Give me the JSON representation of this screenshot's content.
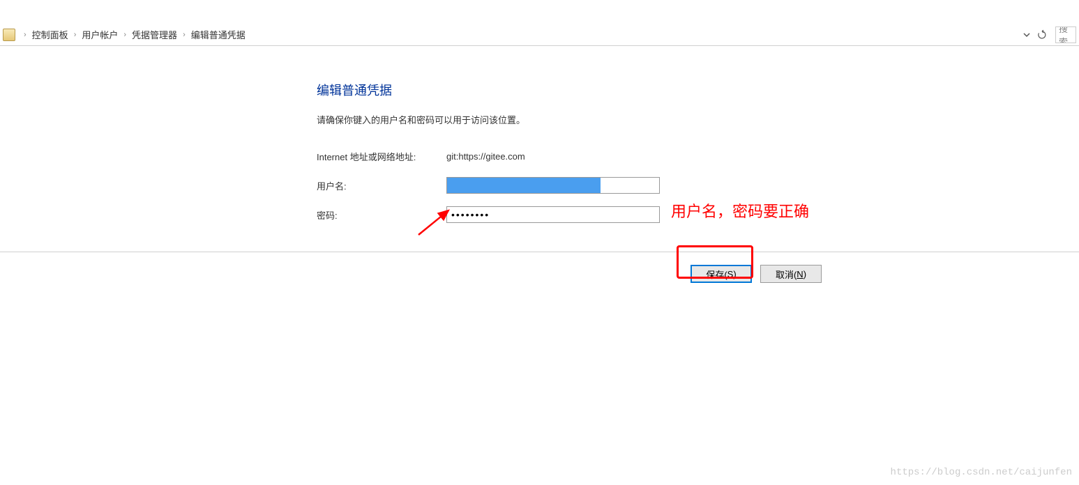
{
  "breadcrumb": {
    "items": [
      "控制面板",
      "用户帐户",
      "凭据管理器",
      "编辑普通凭据"
    ]
  },
  "search": {
    "placeholder": "搜索"
  },
  "page": {
    "title": "编辑普通凭据",
    "instructions": "请确保你键入的用户名和密码可以用于访问该位置。"
  },
  "form": {
    "address_label": "Internet 地址或网络地址:",
    "address_value": "git:https://gitee.com",
    "username_label": "用户名:",
    "password_label": "密码:",
    "password_value": "••••••••"
  },
  "buttons": {
    "save": "保存(",
    "save_key": "S",
    "save_close": ")",
    "cancel": "取消(",
    "cancel_key": "N",
    "cancel_close": ")"
  },
  "annotation": {
    "text": "用户名，密码要正确"
  },
  "watermark": "https://blog.csdn.net/caijunfen"
}
